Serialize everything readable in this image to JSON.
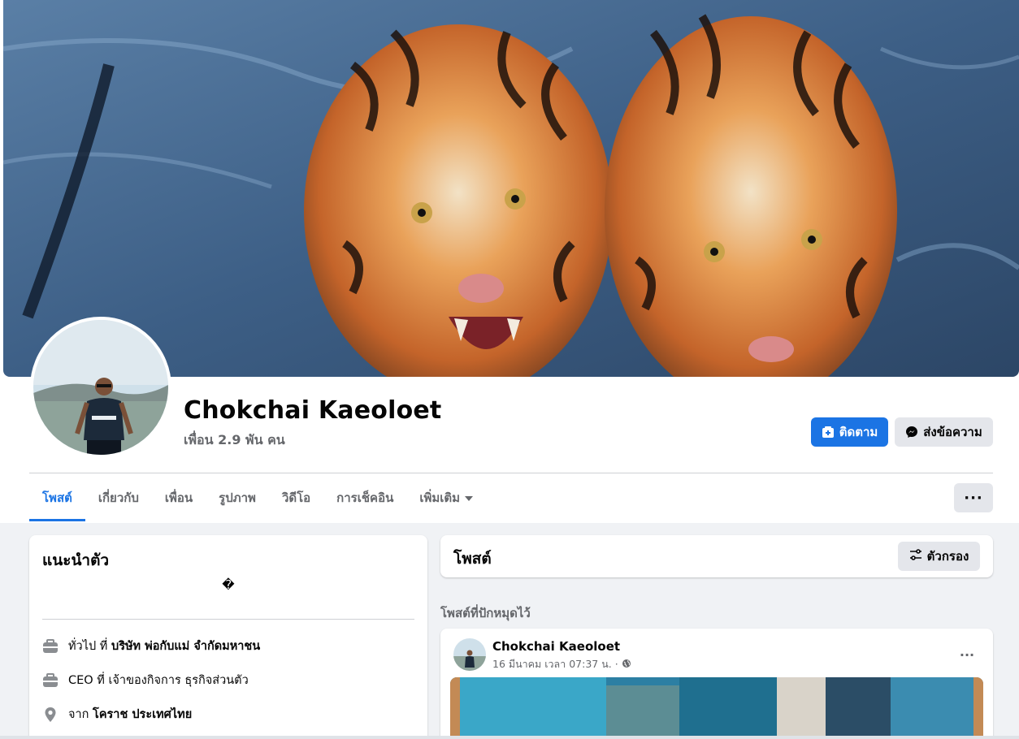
{
  "profile": {
    "name": "Chokchai Kaeoloet",
    "friends_text": "เพื่อน 2.9 พัน คน"
  },
  "actions": {
    "follow_label": "ติดตาม",
    "message_label": "ส่งข้อความ",
    "follow_color": "#1b74e4"
  },
  "tabs": [
    {
      "label": "โพสต์",
      "active": true
    },
    {
      "label": "เกี่ยวกับ"
    },
    {
      "label": "เพื่อน"
    },
    {
      "label": "รูปภาพ"
    },
    {
      "label": "วิดีโอ"
    },
    {
      "label": "การเช็คอิน"
    },
    {
      "label": "เพิ่มเติม"
    }
  ],
  "more_button_label": "···",
  "intro": {
    "title": "แนะนำตัว",
    "bio": "�",
    "items": [
      {
        "icon": "briefcase-icon",
        "prefix": "ทั่วไป ที่ ",
        "bold": "บริษัท พ่อกับแม่ จำกัดมหาชน"
      },
      {
        "icon": "briefcase-icon",
        "prefix": "CEO ที่ เจ้าของกิจการ ธุรกิจส่วนตัว",
        "bold": ""
      },
      {
        "icon": "location-pin-icon",
        "prefix": "จาก ",
        "bold": "โคราช ประเทศไทย"
      }
    ]
  },
  "posts_header": {
    "title": "โพสต์",
    "filter_label": "ตัวกรอง"
  },
  "pinned_label": "โพสต์ที่ปักหมุดไว้",
  "post": {
    "author": "Chokchai Kaeoloet",
    "meta": "16 มีนาคม เวลา 07:37 น. ·",
    "more": "···"
  }
}
